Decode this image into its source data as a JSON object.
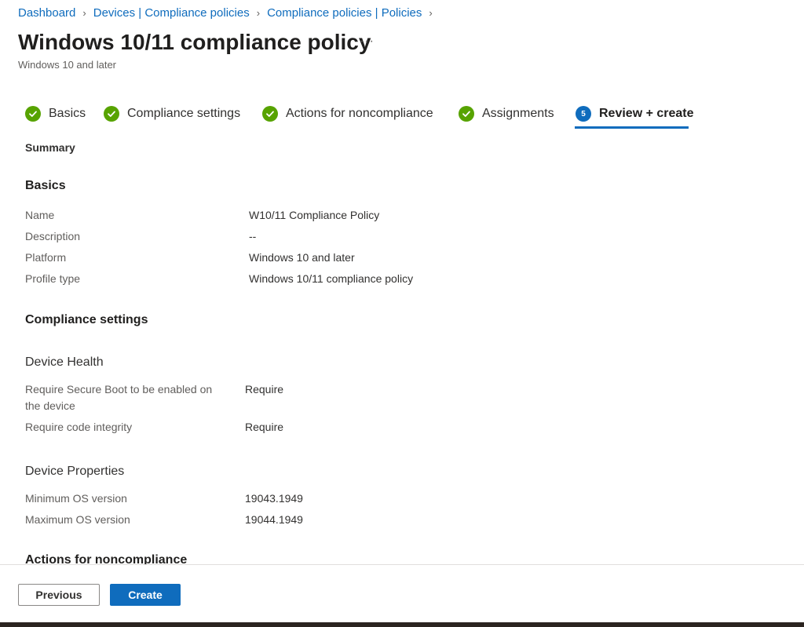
{
  "breadcrumb": {
    "items": [
      "Dashboard",
      "Devices | Compliance policies",
      "Compliance policies | Policies"
    ]
  },
  "header": {
    "title": "Windows 10/11 compliance policy",
    "more": "···",
    "subtitle": "Windows 10 and later"
  },
  "steps": [
    {
      "label": "Basics",
      "state": "complete"
    },
    {
      "label": "Compliance settings",
      "state": "complete"
    },
    {
      "label": "Actions for noncompliance",
      "state": "complete"
    },
    {
      "label": "Assignments",
      "state": "complete"
    },
    {
      "label": "Review + create",
      "state": "active",
      "number": "5"
    }
  ],
  "summary": {
    "heading": "Summary",
    "basics": {
      "heading": "Basics",
      "rows": [
        {
          "label": "Name",
          "value": "W10/11 Compliance Policy"
        },
        {
          "label": "Description",
          "value": "--"
        },
        {
          "label": "Platform",
          "value": "Windows 10 and later"
        },
        {
          "label": "Profile type",
          "value": "Windows 10/11 compliance policy"
        }
      ]
    },
    "compliance": {
      "heading": "Compliance settings",
      "device_health": {
        "heading": "Device Health",
        "rows": [
          {
            "label": "Require Secure Boot to be enabled on the device",
            "value": "Require"
          },
          {
            "label": "Require code integrity",
            "value": "Require"
          }
        ]
      },
      "device_properties": {
        "heading": "Device Properties",
        "rows": [
          {
            "label": "Minimum OS version",
            "value": "19043.1949"
          },
          {
            "label": "Maximum OS version",
            "value": "19044.1949"
          }
        ]
      }
    },
    "actions": {
      "heading": "Actions for noncompliance"
    }
  },
  "footer": {
    "previous": "Previous",
    "create": "Create"
  },
  "colors": {
    "link": "#0f6cbd",
    "success": "#57a300",
    "primary": "#0f6cbd"
  }
}
